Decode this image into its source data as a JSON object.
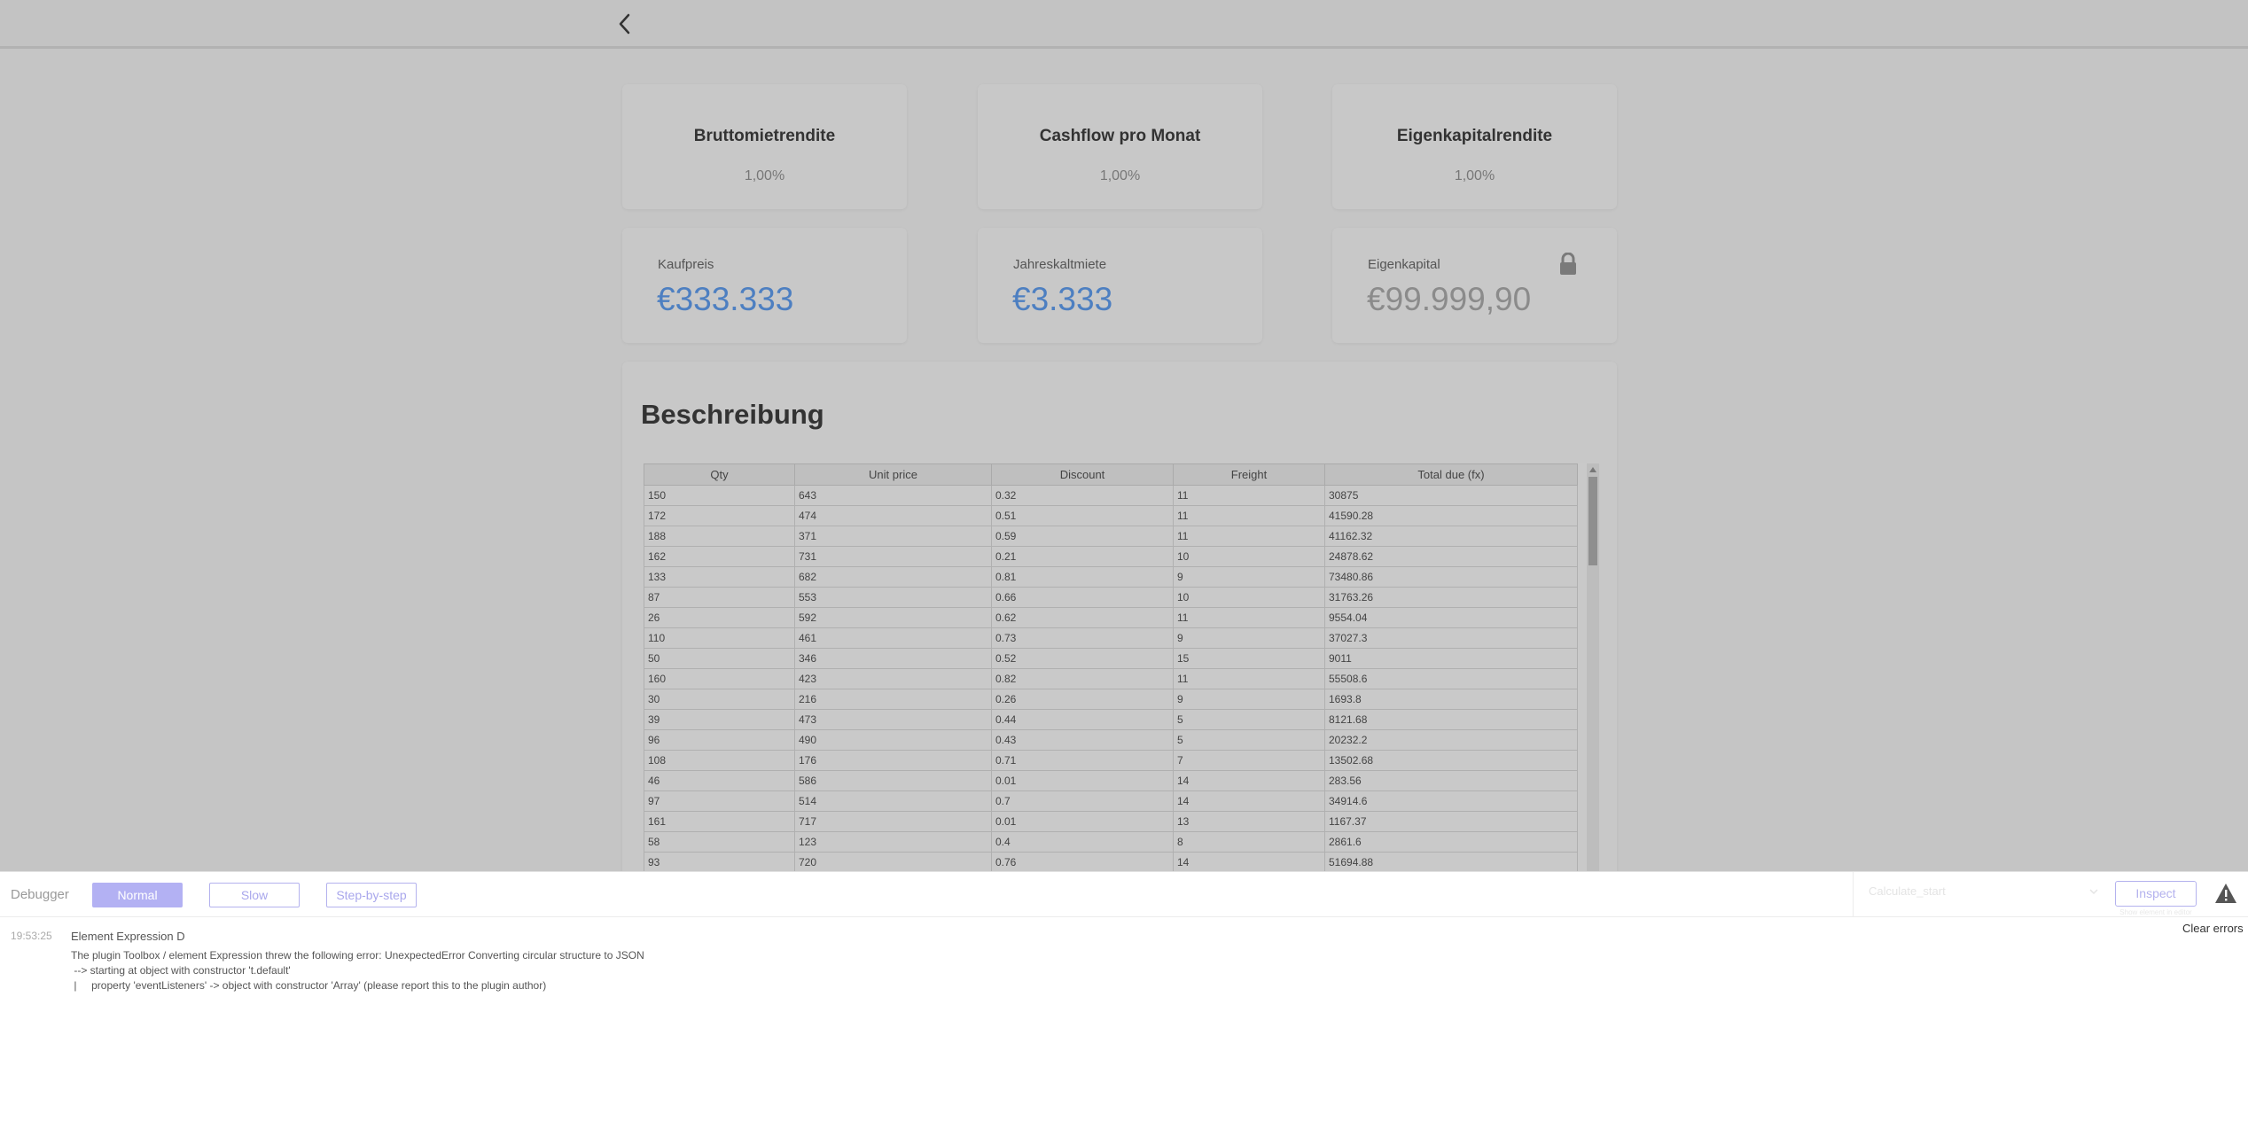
{
  "kpis": [
    {
      "title": "Bruttomietrendite",
      "value": "1,00%"
    },
    {
      "title": "Cashflow pro Monat",
      "value": "1,00%"
    },
    {
      "title": "Eigenkapitalrendite",
      "value": "1,00%"
    }
  ],
  "money": [
    {
      "label": "Kaufpreis",
      "value": "€333.333"
    },
    {
      "label": "Jahreskaltmiete",
      "value": "€3.333"
    },
    {
      "label": "Eigenkapital",
      "value": "€99.999,90",
      "locked": true
    }
  ],
  "description": {
    "title": "Beschreibung",
    "table": {
      "headers": [
        "Qty",
        "Unit price",
        "Discount",
        "Freight",
        "Total due (fx)"
      ],
      "rows": [
        [
          "150",
          "643",
          "0.32",
          "11",
          "30875"
        ],
        [
          "172",
          "474",
          "0.51",
          "11",
          "41590.28"
        ],
        [
          "188",
          "371",
          "0.59",
          "11",
          "41162.32"
        ],
        [
          "162",
          "731",
          "0.21",
          "10",
          "24878.62"
        ],
        [
          "133",
          "682",
          "0.81",
          "9",
          "73480.86"
        ],
        [
          "87",
          "553",
          "0.66",
          "10",
          "31763.26"
        ],
        [
          "26",
          "592",
          "0.62",
          "11",
          "9554.04"
        ],
        [
          "110",
          "461",
          "0.73",
          "9",
          "37027.3"
        ],
        [
          "50",
          "346",
          "0.52",
          "15",
          "9011"
        ],
        [
          "160",
          "423",
          "0.82",
          "11",
          "55508.6"
        ],
        [
          "30",
          "216",
          "0.26",
          "9",
          "1693.8"
        ],
        [
          "39",
          "473",
          "0.44",
          "5",
          "8121.68"
        ],
        [
          "96",
          "490",
          "0.43",
          "5",
          "20232.2"
        ],
        [
          "108",
          "176",
          "0.71",
          "7",
          "13502.68"
        ],
        [
          "46",
          "586",
          "0.01",
          "14",
          "283.56"
        ],
        [
          "97",
          "514",
          "0.7",
          "14",
          "34914.6"
        ],
        [
          "161",
          "717",
          "0.01",
          "13",
          "1167.37"
        ],
        [
          "58",
          "123",
          "0.4",
          "8",
          "2861.6"
        ],
        [
          "93",
          "720",
          "0.76",
          "14",
          "51694.88"
        ]
      ]
    }
  },
  "debugger": {
    "label": "Debugger",
    "modes": [
      "Normal",
      "Slow",
      "Step-by-step"
    ],
    "active_mode": "Normal",
    "select_value": "Calculate_start",
    "inspect_label": "Inspect",
    "inspect_hint": "Show element in editor",
    "clear_label": "Clear errors",
    "log": {
      "time": "19:53:25",
      "title": "Element Expression D",
      "lines": [
        "The plugin Toolbox / element Expression threw the following error: UnexpectedError Converting circular structure to JSON",
        "    --> starting at object with constructor 't.default'",
        "    |     property 'eventListeners' -> object with constructor 'Array' (please report this to the plugin author)"
      ]
    }
  }
}
